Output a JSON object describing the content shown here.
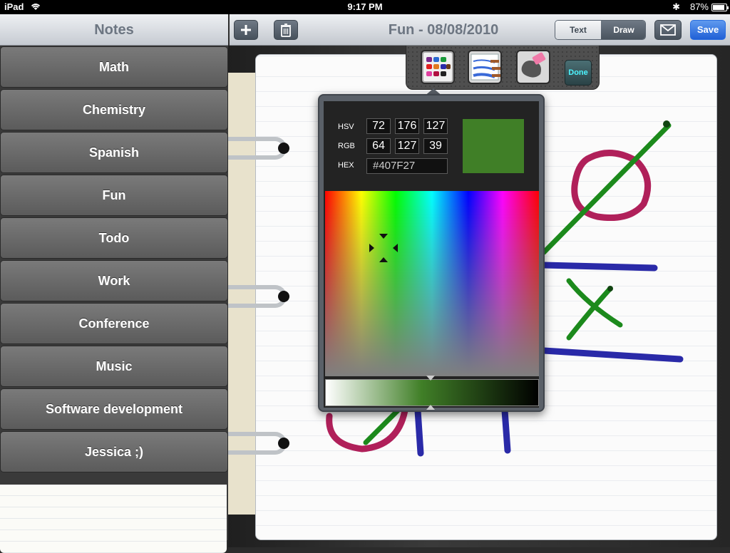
{
  "status_bar": {
    "device": "iPad",
    "time": "9:17 PM",
    "battery": "87%"
  },
  "sidebar": {
    "title": "Notes",
    "items": [
      "Math",
      "Chemistry",
      "Spanish",
      "Fun",
      "Todo",
      "Work",
      "Conference",
      "Music",
      "Software development",
      "Jessica ;)"
    ]
  },
  "toolbar": {
    "add_icon": "plus-icon",
    "trash_icon": "trash-icon",
    "title": "Fun - 08/08/2010",
    "segment": {
      "text_label": "Text",
      "draw_label": "Draw",
      "selected": "Draw"
    },
    "mail_icon": "envelope-icon",
    "save_label": "Save"
  },
  "tool_palette": {
    "tools": [
      "color-palette-icon",
      "brush-size-icon",
      "eraser-icon"
    ],
    "done_label": "Done"
  },
  "color_picker": {
    "hsv_label": "HSV",
    "rgb_label": "RGB",
    "hex_label": "HEX",
    "hsv": {
      "h": "72",
      "s": "176",
      "v": "127"
    },
    "rgb": {
      "r": "64",
      "g": "127",
      "b": "39"
    },
    "hex": "#407F27",
    "swatch_color": "#407F27"
  },
  "colors": {
    "accent_blue": "#2a6ee0",
    "green_ink": "#1c8a1c",
    "crimson_ink": "#b0205a",
    "navy_ink": "#2a2aa8"
  }
}
